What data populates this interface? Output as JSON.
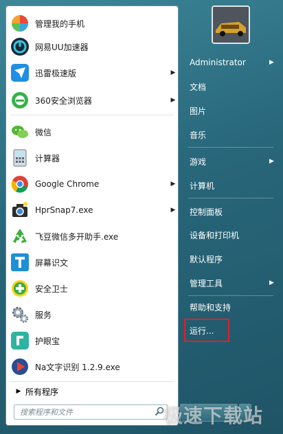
{
  "left_menu": [
    {
      "label": "管理我的手机",
      "icon": "phone-manager-icon",
      "arrow": false
    },
    {
      "label": "网易UU加速器",
      "icon": "uu-accelerator-icon",
      "arrow": false
    },
    {
      "label": "迅雷极速版",
      "icon": "xunlei-icon",
      "arrow": true
    },
    {
      "label": "360安全浏览器",
      "icon": "browser-360-icon",
      "arrow": true
    },
    {
      "label": "微信",
      "icon": "wechat-icon",
      "arrow": false
    },
    {
      "label": "计算器",
      "icon": "calculator-icon",
      "arrow": false
    },
    {
      "label": "Google Chrome",
      "icon": "chrome-icon",
      "arrow": true
    },
    {
      "label": "HprSnap7.exe",
      "icon": "camera-icon",
      "arrow": true
    },
    {
      "label": "飞豆微信多开助手.exe",
      "icon": "recycle-icon",
      "arrow": false
    },
    {
      "label": "屏幕识文",
      "icon": "text-recognition-icon",
      "arrow": false
    },
    {
      "label": "安全卫士",
      "icon": "security-guard-icon",
      "arrow": false
    },
    {
      "label": "服务",
      "icon": "services-gear-icon",
      "arrow": false
    },
    {
      "label": "护眼宝",
      "icon": "eye-protect-icon",
      "arrow": false
    },
    {
      "label": "Na文字识别 1.2.9.exe",
      "icon": "na-ocr-icon",
      "arrow": false
    }
  ],
  "all_programs": "所有程序",
  "search": {
    "placeholder": "搜索程序和文件"
  },
  "right_menu": [
    {
      "label": "Administrator",
      "arrow": true
    },
    {
      "label": "文档",
      "arrow": false
    },
    {
      "label": "图片",
      "arrow": false
    },
    {
      "label": "音乐",
      "arrow": false
    },
    {
      "label": "游戏",
      "arrow": true
    },
    {
      "label": "计算机",
      "arrow": false
    },
    {
      "label": "控制面板",
      "arrow": false
    },
    {
      "label": "设备和打印机",
      "arrow": false
    },
    {
      "label": "默认程序",
      "arrow": false
    },
    {
      "label": "管理工具",
      "arrow": true
    },
    {
      "label": "帮助和支持",
      "arrow": false
    },
    {
      "label": "运行...",
      "arrow": false
    }
  ],
  "watermark": "极速下载站",
  "colors": {
    "highlight_box": "#e0202b",
    "panel_bg": "#2d6f83"
  }
}
